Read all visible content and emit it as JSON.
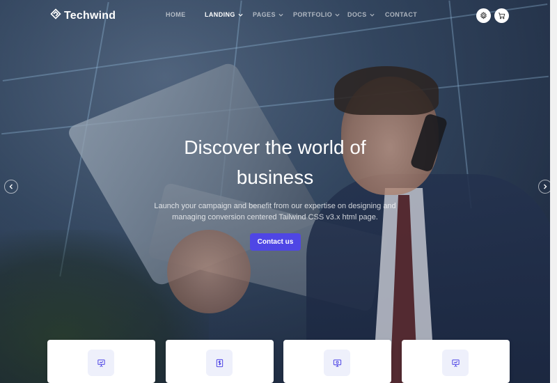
{
  "brand": {
    "name": "Techwind",
    "logo_icon": "techwind-logo-icon"
  },
  "nav": {
    "items": [
      {
        "label": "HOME",
        "dropdown": false,
        "active": false
      },
      {
        "label": "LANDING",
        "dropdown": true,
        "active": true
      },
      {
        "label": "PAGES",
        "dropdown": true,
        "active": false
      },
      {
        "label": "PORTFOLIO",
        "dropdown": true,
        "active": false
      },
      {
        "label": "DOCS",
        "dropdown": true,
        "active": false
      },
      {
        "label": "CONTACT",
        "dropdown": false,
        "active": false
      }
    ],
    "actions": [
      {
        "icon": "settings-icon"
      },
      {
        "icon": "cart-icon"
      }
    ]
  },
  "hero": {
    "title_line1": "Discover the world of",
    "title_line2": "business",
    "subtitle_line1": "Launch your campaign and benefit from our expertise on designing and",
    "subtitle_line2": "managing conversion centered Tailwind CSS v3.x html page.",
    "cta_label": "Contact us",
    "prev_icon": "chevron-left-icon",
    "next_icon": "chevron-right-icon"
  },
  "features": {
    "cards": [
      {
        "icon": "presentation-icon"
      },
      {
        "icon": "dollar-document-icon"
      },
      {
        "icon": "monitor-icon"
      },
      {
        "icon": "presentation-icon"
      }
    ]
  },
  "colors": {
    "accent": "#4f46e5",
    "overlay": "#1c283e",
    "card_icon_bg": "#eef0fb"
  }
}
